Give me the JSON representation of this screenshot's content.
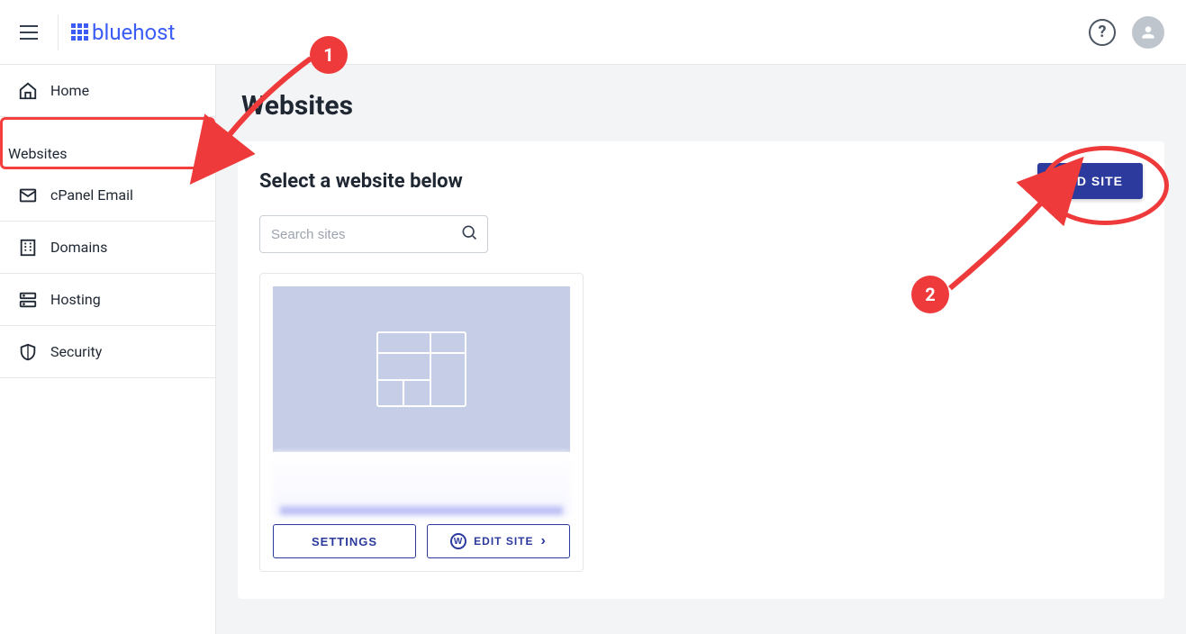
{
  "header": {
    "brand": "bluehost",
    "help_tooltip": "Help",
    "user_tooltip": "Account"
  },
  "sidebar": {
    "items": [
      {
        "label": "Home"
      },
      {
        "label": "Websites"
      },
      {
        "label": "cPanel Email"
      },
      {
        "label": "Domains"
      },
      {
        "label": "Hosting"
      },
      {
        "label": "Security"
      }
    ],
    "active_index": 1
  },
  "page": {
    "title": "Websites",
    "subtitle": "Select a website below",
    "add_site_label": "ADD SITE",
    "search_placeholder": "Search sites"
  },
  "site_card": {
    "settings_label": "SETTINGS",
    "edit_label": "EDIT SITE"
  },
  "annotations": {
    "one": "1",
    "two": "2"
  }
}
